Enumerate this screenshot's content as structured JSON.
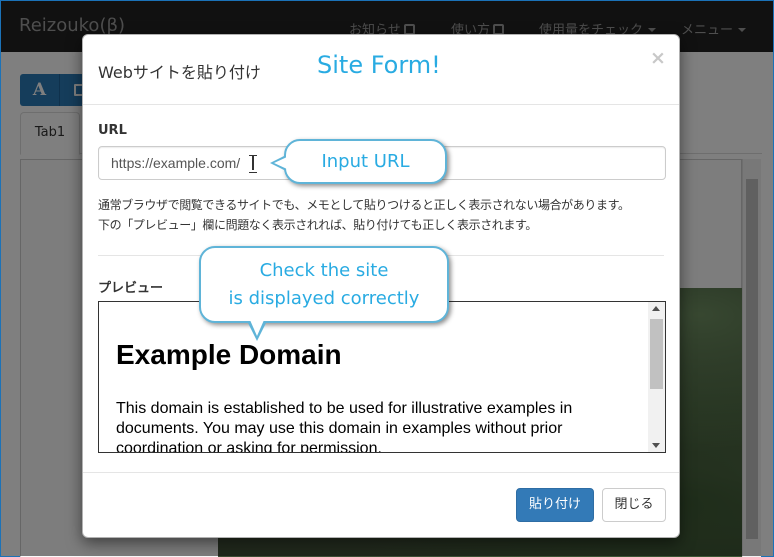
{
  "app": {
    "brand": "Reizouko(β)",
    "nav": {
      "news": "お知らせ",
      "usage": "使い方",
      "check_usage": "使用量をチェック",
      "menu": "メニュー"
    }
  },
  "editor": {
    "tab1": "Tab1",
    "tool_text_glyph": "A"
  },
  "modal": {
    "title": "Webサイトを貼り付け",
    "close_glyph": "×",
    "url_label": "URL",
    "url_value": "https://example.com/",
    "help_line1": "通常ブラウザで閲覧できるサイトでも、メモとして貼りつけると正しく表示されない場合があります。",
    "help_line2": "下の「プレビュー」欄に問題なく表示されれば、貼り付けても正しく表示されます。",
    "preview_label": "プレビュー",
    "preview": {
      "heading": "Example Domain",
      "body": "This domain is established to be used for illustrative examples in documents. You may use this domain in examples without prior coordination or asking for permission."
    },
    "paste_button": "貼り付け",
    "close_button": "閉じる"
  },
  "annotations": {
    "site_form": "Site Form!",
    "input_url": "Input URL",
    "check_line1": "Check the site",
    "check_line2": "is displayed correctly"
  },
  "colors": {
    "navbar": "#222222",
    "primary": "#337ab7",
    "annotation": "#29abe2",
    "bubble_border": "#5fb4d8"
  },
  "icons": {
    "external_link": "external-link-icon",
    "caret": "caret-down-icon",
    "image": "image-icon",
    "text_cursor": "text-cursor-icon"
  }
}
